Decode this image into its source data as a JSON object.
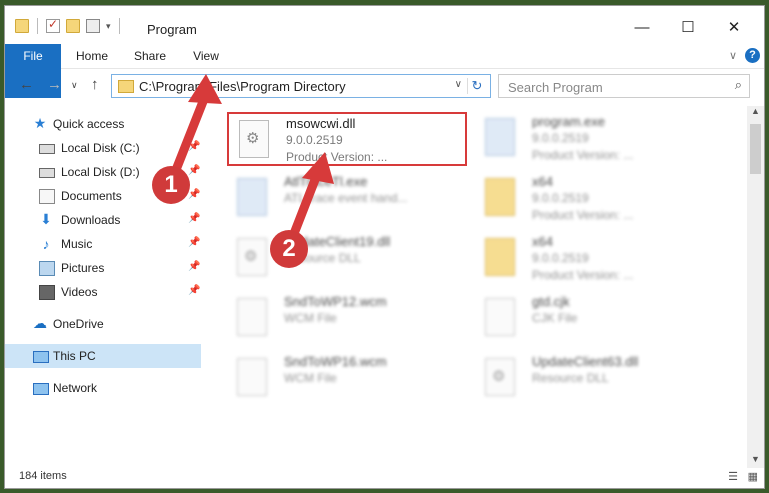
{
  "window": {
    "title": "Program",
    "controls": {
      "minimize": "—",
      "maximize": "☐",
      "close": "✕"
    }
  },
  "ribbon": {
    "tabs": [
      {
        "label": "File"
      },
      {
        "label": "Home"
      },
      {
        "label": "Share"
      },
      {
        "label": "View"
      }
    ],
    "chevron": "∨",
    "help": "?"
  },
  "nav": {
    "back": "←",
    "forward": "→",
    "recent": "∨",
    "up": "↑",
    "address": "C:\\Program Files\\Program Directory",
    "address_drop": "∨",
    "refresh": "↻"
  },
  "search": {
    "placeholder": "Search Program",
    "icon": "⌕"
  },
  "sidebar": {
    "items": [
      {
        "label": "Quick access",
        "icon": "star-icon",
        "pinned": false
      },
      {
        "label": "Local Disk (C:)",
        "icon": "drive-icon",
        "pinned": true
      },
      {
        "label": "Local Disk (D:)",
        "icon": "drive-icon",
        "pinned": true
      },
      {
        "label": "Documents",
        "icon": "documents-icon",
        "pinned": true
      },
      {
        "label": "Downloads",
        "icon": "download-icon",
        "pinned": true
      },
      {
        "label": "Music",
        "icon": "music-icon",
        "pinned": true
      },
      {
        "label": "Pictures",
        "icon": "pictures-icon",
        "pinned": true
      },
      {
        "label": "Videos",
        "icon": "videos-icon",
        "pinned": true
      },
      {
        "label": "OneDrive",
        "icon": "cloud-icon",
        "pinned": false
      },
      {
        "label": "This PC",
        "icon": "computer-icon",
        "pinned": false,
        "selected": true
      },
      {
        "label": "Network",
        "icon": "network-icon",
        "pinned": false
      }
    ],
    "pin_glyph": "📌"
  },
  "files": [
    {
      "name": "msowcwi.dll",
      "line1": "9.0.0.2519",
      "line2": "Product Version:     ...",
      "icon": "gear-file-icon",
      "highlighted": true
    },
    {
      "name": "program.exe",
      "line1": "9.0.0.2519",
      "line2": "Product Version:     ...",
      "icon": "exe-icon"
    },
    {
      "name": "AtlTraceTl.exe",
      "line1": "ATL trace event hand...",
      "line2": "",
      "icon": "exe-icon"
    },
    {
      "name": "x64",
      "line1": "9.0.0.2519",
      "line2": "Product Version:     ...",
      "icon": "folder-icon"
    },
    {
      "name": "UpdateClient19.dll",
      "line1": "Resource DLL",
      "line2": "",
      "icon": "gear-file-icon"
    },
    {
      "name": "x64",
      "line1": "9.0.0.2519",
      "line2": "Product Version:     ...",
      "icon": "folder-icon"
    },
    {
      "name": "SndToWP12.wcm",
      "line1": "WCM File",
      "line2": "",
      "icon": "file-icon"
    },
    {
      "name": "gtd.cjk",
      "line1": "CJK File",
      "line2": "",
      "icon": "file-icon"
    },
    {
      "name": "SndToWP16.wcm",
      "line1": "WCM File",
      "line2": "",
      "icon": "file-icon"
    },
    {
      "name": "UpdateClient63.dll",
      "line1": "Resource DLL",
      "line2": "",
      "icon": "gear-file-icon"
    }
  ],
  "status": {
    "count": "184 items",
    "details_icon": "☰",
    "tiles_icon": "▦"
  },
  "annotations": [
    {
      "label": "1"
    },
    {
      "label": "2"
    }
  ],
  "colors": {
    "accent": "#1a6fc2",
    "highlight": "#d73a3a",
    "selected": "#cce4f7"
  }
}
